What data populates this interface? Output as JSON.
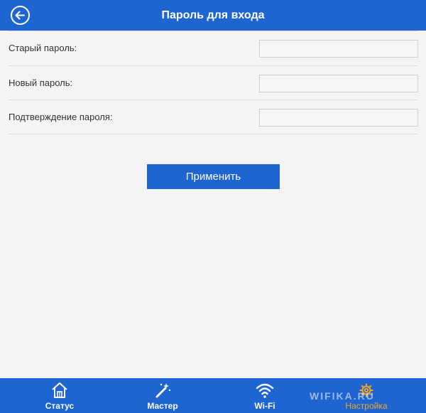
{
  "header": {
    "title": "Пароль для входа",
    "back_icon": "back-arrow-icon"
  },
  "form": {
    "rows": [
      {
        "label": "Старый пароль:",
        "value": ""
      },
      {
        "label": "Новый пароль:",
        "value": ""
      },
      {
        "label": "Подтверждение пароля:",
        "value": ""
      }
    ],
    "apply_label": "Применить"
  },
  "tabbar": {
    "tabs": [
      {
        "label": "Статус",
        "icon": "home-icon"
      },
      {
        "label": "Мастер",
        "icon": "magic-wand-icon"
      },
      {
        "label": "Wi-Fi",
        "icon": "wifi-icon"
      },
      {
        "label": "Настройка",
        "icon": "gear-icon",
        "active": true
      }
    ],
    "watermark": "WIFIKA.RU"
  },
  "colors": {
    "primary": "#1e65d1",
    "active_tab": "#f4a623",
    "background": "#f4f4f4"
  }
}
